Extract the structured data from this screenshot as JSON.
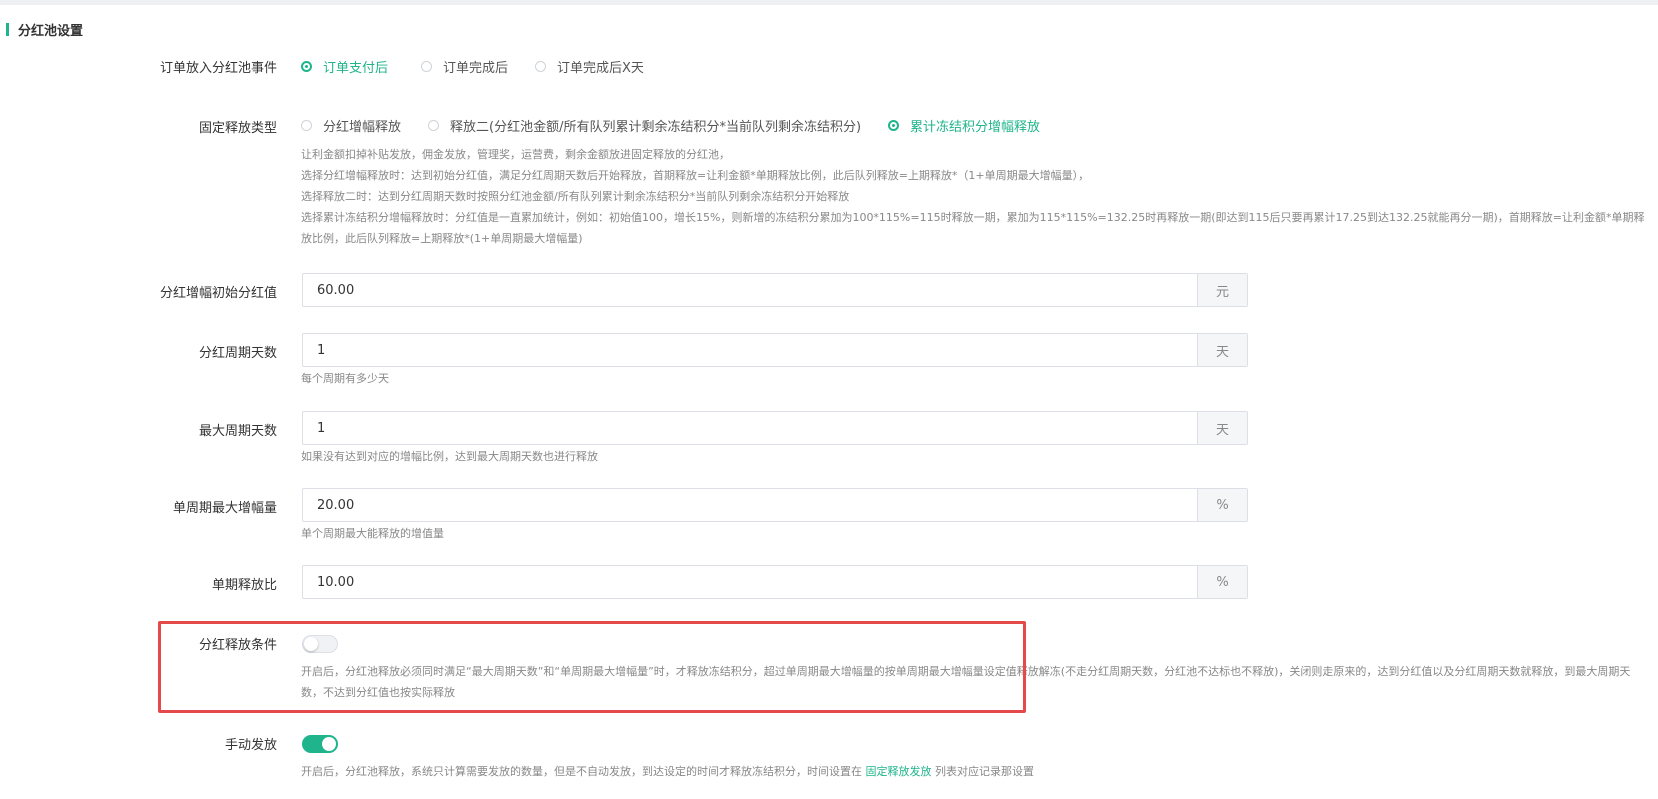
{
  "section": {
    "title": "分红池设置"
  },
  "order_event": {
    "label": "订单放入分红池事件",
    "options": [
      {
        "label": "订单支付后",
        "checked": true
      },
      {
        "label": "订单完成后",
        "checked": false
      },
      {
        "label": "订单完成后X天",
        "checked": false
      }
    ]
  },
  "release_type": {
    "label": "固定释放类型",
    "options": [
      {
        "label": "分红增幅释放",
        "checked": false
      },
      {
        "label": "释放二(分红池金额/所有队列累计剩余冻结积分*当前队列剩余冻结积分)",
        "checked": false
      },
      {
        "label": "累计冻结积分增幅释放",
        "checked": true
      }
    ],
    "help": [
      "让利金额扣掉补贴发放，佣金发放，管理奖，运营费，剩余金额放进固定释放的分红池，",
      "选择分红增幅释放时：达到初始分红值，满足分红周期天数后开始释放，首期释放=让利金额*单期释放比例，此后队列释放=上期释放*（1+单周期最大增幅量），",
      "选择释放二时：达到分红周期天数时按照分红池金额/所有队列累计剩余冻结积分*当前队列剩余冻结积分开始释放",
      "选择累计冻结积分增幅释放时：分红值是一直累加统计，例如：初始值100，增长15%，则新增的冻结积分累加为100*115%=115时释放一期，累加为115*115%=132.25时再释放一期(即达到115后只要再累计17.25到达132.25就能再分一期)，首期释放=让利金额*单期释放比例，此后队列释放=上期释放*(1+单周期最大增幅量)"
    ]
  },
  "initial_value": {
    "label": "分红增幅初始分红值",
    "value": "60.00",
    "unit": "元"
  },
  "cycle_days": {
    "label": "分红周期天数",
    "value": "1",
    "unit": "天",
    "help": "每个周期有多少天"
  },
  "max_cycle_days": {
    "label": "最大周期天数",
    "value": "1",
    "unit": "天",
    "help": "如果没有达到对应的增幅比例，达到最大周期天数也进行释放"
  },
  "max_increase": {
    "label": "单周期最大增幅量",
    "value": "20.00",
    "unit": "%",
    "help": "单个周期最大能释放的增值量"
  },
  "release_ratio": {
    "label": "单期释放比",
    "value": "10.00",
    "unit": "%"
  },
  "release_condition": {
    "label": "分红释放条件",
    "enabled": false,
    "help": "开启后，分红池释放必须同时满足“最大周期天数”和“单周期最大增幅量”时，才释放冻结积分，超过单周期最大增幅量的按单周期最大增幅量设定值释放解冻(不走分红周期天数，分红池不达标也不释放)，关闭则走原来的，达到分红值以及分红周期天数就释放，到最大周期天数，不达到分红值也按实际释放"
  },
  "manual_release": {
    "label": "手动发放",
    "enabled": true,
    "help_before": "开启后，分红池释放，系统只计算需要发放的数量，但是不自动发放，到达设定的时间才释放冻结积分，时间设置在 ",
    "help_link": "固定释放发放",
    "help_after": " 列表对应记录那设置"
  },
  "colors": {
    "accent": "#1fb48b",
    "highlight": "#e54a4a"
  }
}
